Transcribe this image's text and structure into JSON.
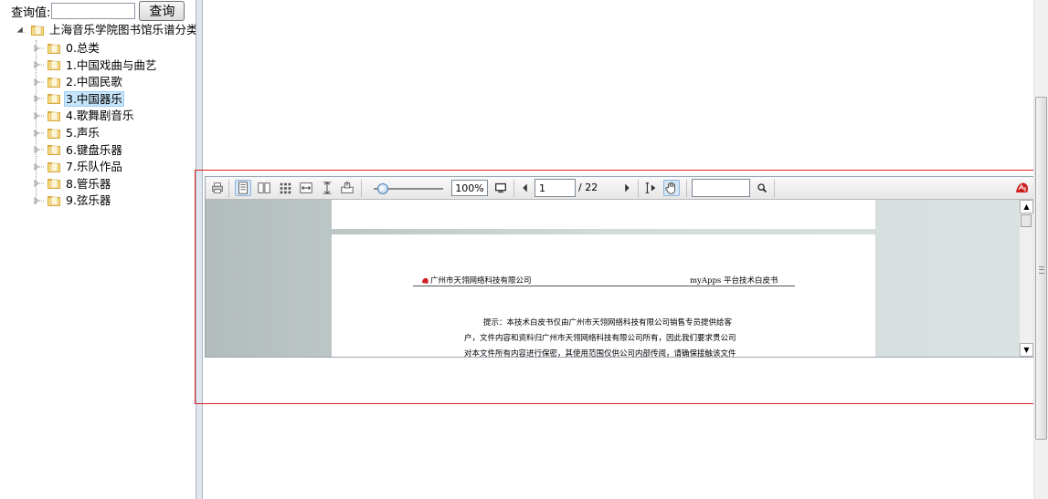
{
  "search": {
    "label": "查询值:",
    "value": "",
    "button": "查询"
  },
  "tree": {
    "root": "上海音乐学院图书馆乐谱分类",
    "items": [
      {
        "label": "0.总类",
        "selected": false
      },
      {
        "label": "1.中国戏曲与曲艺",
        "selected": false
      },
      {
        "label": "2.中国民歌",
        "selected": false
      },
      {
        "label": "3.中国器乐",
        "selected": true
      },
      {
        "label": "4.歌舞剧音乐",
        "selected": false
      },
      {
        "label": "5.声乐",
        "selected": false
      },
      {
        "label": "6.键盘乐器",
        "selected": false
      },
      {
        "label": "7.乐队作品",
        "selected": false
      },
      {
        "label": "8.管乐器",
        "selected": false
      },
      {
        "label": "9.弦乐器",
        "selected": false
      }
    ]
  },
  "viewer": {
    "zoom": "100%",
    "zoom_fraction": 0.1,
    "current_page": "1",
    "total_pages": "/ 22",
    "find_value": "",
    "doc": {
      "header_left": "广州市天翎网络科技有限公司",
      "header_right": "myApps 平台技术白皮书",
      "lines": [
        "提示：本技术白皮书仅由广州市天翎网络科技有限公司销售专员提供给客",
        "户，文件内容和资料归广州市天翎网络科技有限公司所有，因此我们要求贵公司",
        "对本文件所有内容进行保密，其使用范围仅供公司内部传阅，请确保接触该文件"
      ]
    }
  },
  "colors": {
    "selection": "#c6e4fa",
    "frame": "#e02020",
    "logo_red": "#cc1f1f"
  }
}
